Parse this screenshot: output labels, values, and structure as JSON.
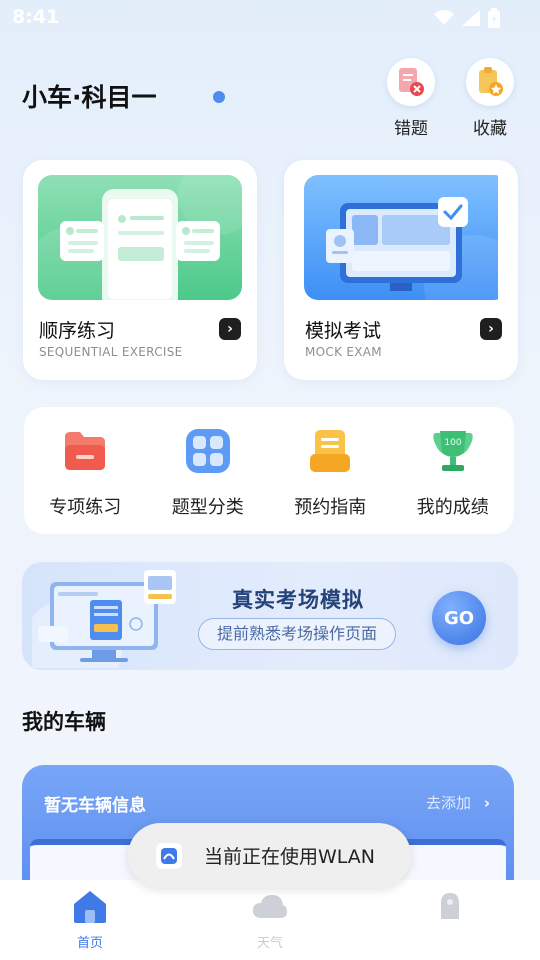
{
  "status_bar": {
    "time": "8:41"
  },
  "header": {
    "title": "小车·科目一",
    "wrong_label": "错题",
    "favorites_label": "收藏"
  },
  "cards": [
    {
      "title": "顺序练习",
      "subtitle": "SEQUENTIAL EXERCISE"
    },
    {
      "title": "模拟考试",
      "subtitle": "MOCK EXAM"
    }
  ],
  "grid": [
    {
      "label": "专项练习",
      "icon": "folder-icon"
    },
    {
      "label": "题型分类",
      "icon": "apps-icon"
    },
    {
      "label": "预约指南",
      "icon": "clipboard-icon"
    },
    {
      "label": "我的成绩",
      "icon": "trophy-icon"
    }
  ],
  "banner": {
    "title": "真实考场模拟",
    "subtitle": "提前熟悉考场操作页面",
    "go_label": "GO"
  },
  "vehicles": {
    "section_title": "我的车辆",
    "empty_text": "暂无车辆信息",
    "add_label": "去添加"
  },
  "toast": {
    "text": "当前正在使用WLAN"
  },
  "bottom_nav": [
    {
      "label": "首页",
      "active": true
    },
    {
      "label": "天气",
      "active": false
    },
    {
      "label": "",
      "active": false
    }
  ],
  "colors": {
    "accent": "#4f8cf0",
    "active_nav": "#3f7ae6",
    "inactive_nav": "#c9ccd2"
  }
}
